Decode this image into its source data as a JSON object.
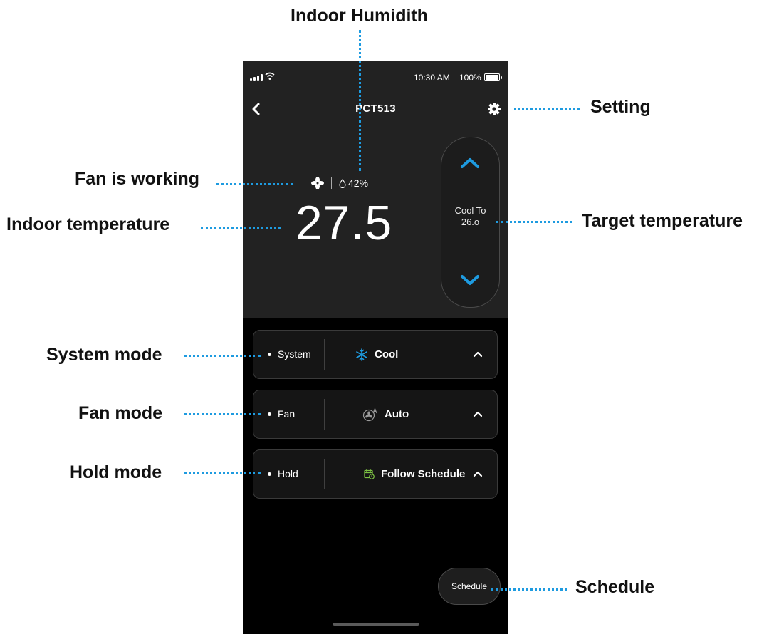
{
  "status_bar": {
    "time": "10:30 AM",
    "battery": "100%"
  },
  "header": {
    "title": "PCT513"
  },
  "indoor": {
    "humidity": "42%",
    "temperature": "27.5"
  },
  "target": {
    "label": "Cool To",
    "value": "26.o"
  },
  "modes": [
    {
      "label": "System",
      "value": "Cool",
      "icon": "snowflake-icon",
      "icon_color": "#1e9be0"
    },
    {
      "label": "Fan",
      "value": "Auto",
      "icon": "fan-auto-icon",
      "icon_color": "#9a9a9a"
    },
    {
      "label": "Hold",
      "value": "Follow Schedule",
      "icon": "calendar-icon",
      "icon_color": "#7cc243"
    }
  ],
  "schedule_button": "Schedule",
  "annotations": {
    "humidity": "Indoor Humidith",
    "setting": "Setting",
    "fan_working": "Fan is working",
    "indoor_temperature": "Indoor temperature",
    "target_temperature": "Target temperature",
    "system_mode": "System mode",
    "fan_mode": "Fan mode",
    "hold_mode": "Hold mode",
    "schedule": "Schedule"
  },
  "colors": {
    "accent": "#1e9be0",
    "leader": "#1e9be0",
    "calendar": "#7cc243",
    "background": "#000000",
    "header_bg": "#222222"
  }
}
